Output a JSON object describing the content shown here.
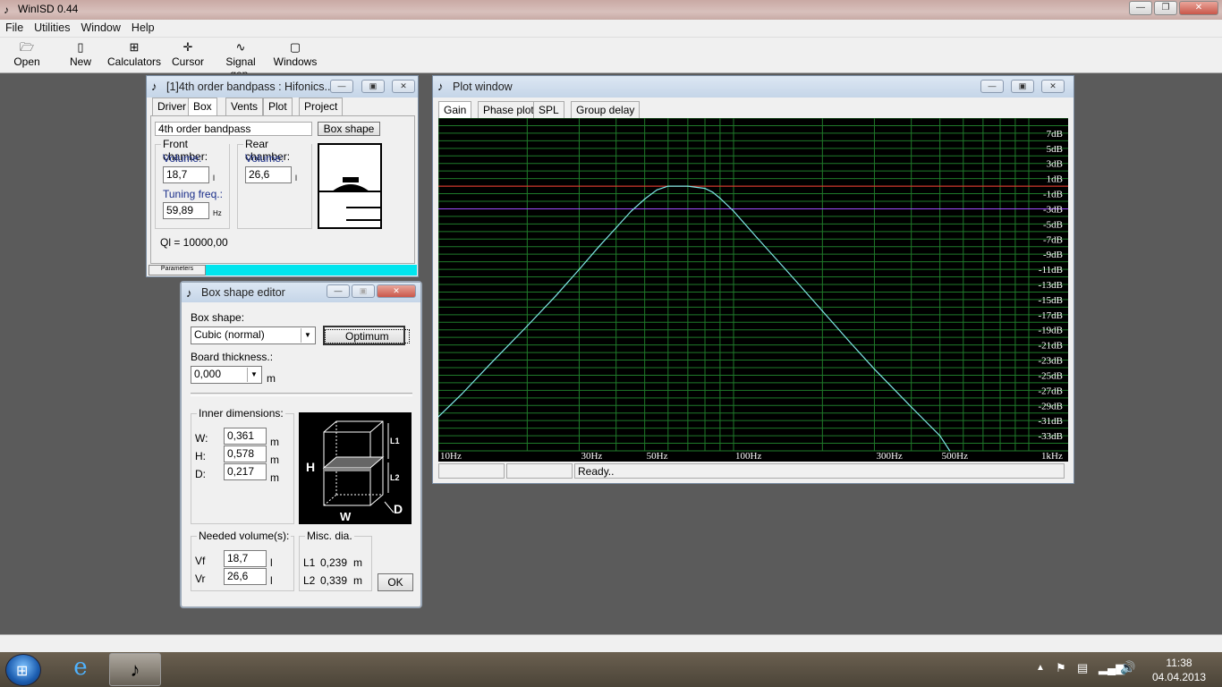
{
  "app": {
    "title": "WinISD 0.44",
    "buttons": [
      "—",
      "❐",
      "✕"
    ]
  },
  "menu": [
    "File",
    "Utilities",
    "Window",
    "Help"
  ],
  "toolbar": [
    {
      "label": "Open",
      "icon": "folder-open-icon"
    },
    {
      "label": "New",
      "icon": "new-document-icon"
    },
    {
      "label": "Calculators",
      "icon": "calculator-icon"
    },
    {
      "label": "Cursor",
      "icon": "cursor-icon"
    },
    {
      "label": "Signal gen.",
      "icon": "signal-generator-icon"
    },
    {
      "label": "Windows",
      "icon": "window-icon"
    }
  ],
  "project": {
    "title": "[1]4th order bandpass : Hifonics...",
    "tabs": [
      "Driver",
      "Box",
      "Vents",
      "Plot",
      "Project"
    ],
    "box_type": "4th order bandpass",
    "box_shape_btn": "Box shape",
    "front": {
      "label": "Front chamber:",
      "volume_label": "Volume:",
      "volume": "18,7",
      "volume_unit": "l",
      "tuning_label": "Tuning freq.:",
      "tuning": "59,89",
      "tuning_unit": "Hz"
    },
    "rear": {
      "label": "Rear chamber:",
      "volume_label": "Volume:",
      "volume": "26,6",
      "volume_unit": "l"
    },
    "ql": "Ql = 10000,00",
    "status_tab": "Parameters"
  },
  "plotwin": {
    "title": "Plot window",
    "tabs": [
      "Gain",
      "Phase plot",
      "SPL",
      "Group delay"
    ],
    "status": "Ready.."
  },
  "chart_data": {
    "type": "line",
    "title": "",
    "xlabel": "",
    "ylabel": "",
    "x_scale": "log",
    "xlim": [
      10,
      1000
    ],
    "ylim": [
      -35,
      9
    ],
    "x_ticks": [
      "10Hz",
      "30Hz",
      "50Hz",
      "100Hz",
      "300Hz",
      "500Hz",
      "1kHz"
    ],
    "x_tick_values": [
      10,
      30,
      50,
      100,
      300,
      500,
      1000
    ],
    "y_ticks": [
      "7dB",
      "5dB",
      "3dB",
      "1dB",
      "-1dB",
      "-3dB",
      "-5dB",
      "-7dB",
      "-9dB",
      "-11dB",
      "-13dB",
      "-15dB",
      "-17dB",
      "-19dB",
      "-21dB",
      "-23dB",
      "-25dB",
      "-27dB",
      "-29dB",
      "-31dB",
      "-33dB"
    ],
    "y_tick_values": [
      7,
      5,
      3,
      1,
      -1,
      -3,
      -5,
      -7,
      -9,
      -11,
      -13,
      -15,
      -17,
      -19,
      -21,
      -23,
      -25,
      -27,
      -29,
      -31,
      -33
    ],
    "reference_lines": [
      {
        "y": 0,
        "color": "#ff3030"
      },
      {
        "y": -3,
        "color": "#a050ff"
      }
    ],
    "grid": true,
    "series": [
      {
        "color": "#7fe6e6",
        "x": [
          10,
          12,
          15,
          20,
          25,
          30,
          35,
          40,
          45,
          50,
          55,
          60,
          70,
          80,
          85,
          90,
          100,
          120,
          150,
          200,
          250,
          300,
          400,
          500,
          540
        ],
        "y": [
          -30.5,
          -27.5,
          -23.5,
          -18.5,
          -14.5,
          -11.0,
          -8.0,
          -5.5,
          -3.3,
          -1.7,
          -0.5,
          0.0,
          0.0,
          -0.3,
          -0.8,
          -1.6,
          -3.3,
          -6.8,
          -11.0,
          -16.5,
          -20.8,
          -24.2,
          -29.2,
          -33.0,
          -35.0
        ]
      }
    ]
  },
  "shape": {
    "title": "Box shape editor",
    "box_shape_label": "Box shape:",
    "box_shape_value": "Cubic (normal)",
    "optimum_btn": "Optimum",
    "board_label": "Board thickness.:",
    "board_value": "0,000",
    "board_unit": "m",
    "inner_label": "Inner dimensions:",
    "dims": [
      {
        "label": "W:",
        "value": "0,361",
        "unit": "m"
      },
      {
        "label": "H:",
        "value": "0,578",
        "unit": "m"
      },
      {
        "label": "D:",
        "value": "0,217",
        "unit": "m"
      }
    ],
    "needed_label": "Needed volume(s):",
    "needed": [
      {
        "label": "Vf",
        "value": "18,7",
        "unit": "l"
      },
      {
        "label": "Vr",
        "value": "26,6",
        "unit": "l"
      }
    ],
    "misc_label": "Misc. dia.",
    "misc": [
      {
        "label": "L1",
        "value": "0,239",
        "unit": "m"
      },
      {
        "label": "L2",
        "value": "0,339",
        "unit": "m"
      }
    ],
    "ok_btn": "OK",
    "diagram_letters": {
      "h": "H",
      "w": "W",
      "d": "D",
      "l1": "L1",
      "l2": "L2"
    }
  },
  "taskbar": {
    "time": "11:38",
    "date": "04.04.2013"
  }
}
